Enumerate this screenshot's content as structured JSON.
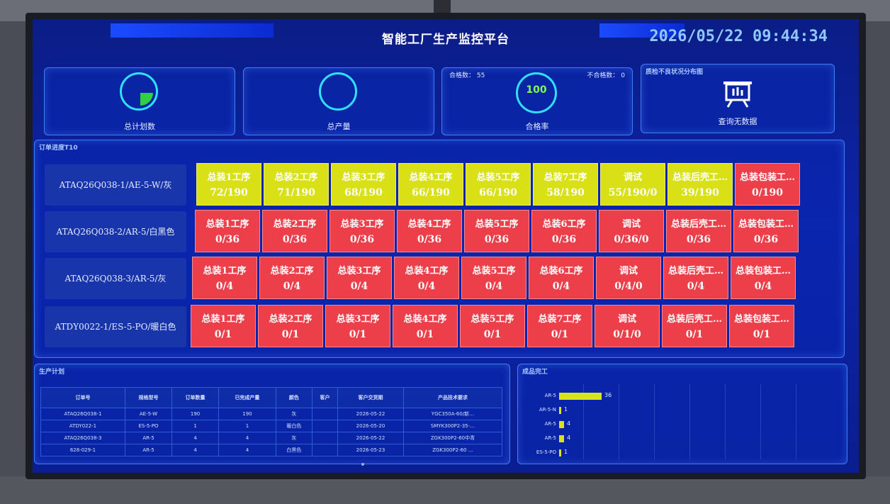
{
  "header": {
    "title": "智能工厂生产监控平台",
    "datetime": "2026/05/22  09:44:34"
  },
  "kpis": {
    "total_plan": {
      "label": "总计划数",
      "progress": 0.25
    },
    "total_output": {
      "label": "总产量"
    },
    "pass_rate": {
      "label": "合格率",
      "value": "100",
      "qualified_label": "合格数：",
      "qualified": "55",
      "unqualified_label": "不合格数：",
      "unqualified": "0"
    },
    "defects": {
      "title": "质检不良状况分布图",
      "empty": "查询无数据"
    }
  },
  "orders": {
    "title": "订单进度T10",
    "rows": [
      {
        "label": "ATAQ26Q038-1/AE-5-W/灰",
        "cells": [
          {
            "name": "总装1工序",
            "count": "72/190",
            "status": "yellow"
          },
          {
            "name": "总装2工序",
            "count": "71/190",
            "status": "yellow"
          },
          {
            "name": "总装3工序",
            "count": "68/190",
            "status": "yellow"
          },
          {
            "name": "总装4工序",
            "count": "66/190",
            "status": "yellow"
          },
          {
            "name": "总装5工序",
            "count": "66/190",
            "status": "yellow"
          },
          {
            "name": "总装7工序",
            "count": "58/190",
            "status": "yellow"
          },
          {
            "name": "调试",
            "count": "55/190/0",
            "status": "yellow"
          },
          {
            "name": "总装后壳工…",
            "count": "39/190",
            "status": "yellow"
          },
          {
            "name": "总装包装工…",
            "count": "0/190",
            "status": "red"
          }
        ]
      },
      {
        "label": "ATAQ26Q038-2/AR-5/白黑色",
        "cells": [
          {
            "name": "总装1工序",
            "count": "0/36",
            "status": "red"
          },
          {
            "name": "总装2工序",
            "count": "0/36",
            "status": "red"
          },
          {
            "name": "总装3工序",
            "count": "0/36",
            "status": "red"
          },
          {
            "name": "总装4工序",
            "count": "0/36",
            "status": "red"
          },
          {
            "name": "总装5工序",
            "count": "0/36",
            "status": "red"
          },
          {
            "name": "总装6工序",
            "count": "0/36",
            "status": "red"
          },
          {
            "name": "调试",
            "count": "0/36/0",
            "status": "red"
          },
          {
            "name": "总装后壳工…",
            "count": "0/36",
            "status": "red"
          },
          {
            "name": "总装包装工…",
            "count": "0/36",
            "status": "red"
          }
        ]
      },
      {
        "label": "ATAQ26Q038-3/AR-5/灰",
        "cells": [
          {
            "name": "总装1工序",
            "count": "0/4",
            "status": "red"
          },
          {
            "name": "总装2工序",
            "count": "0/4",
            "status": "red"
          },
          {
            "name": "总装3工序",
            "count": "0/4",
            "status": "red"
          },
          {
            "name": "总装4工序",
            "count": "0/4",
            "status": "red"
          },
          {
            "name": "总装5工序",
            "count": "0/4",
            "status": "red"
          },
          {
            "name": "总装6工序",
            "count": "0/4",
            "status": "red"
          },
          {
            "name": "调试",
            "count": "0/4/0",
            "status": "red"
          },
          {
            "name": "总装后壳工…",
            "count": "0/4",
            "status": "red"
          },
          {
            "name": "总装包装工…",
            "count": "0/4",
            "status": "red"
          }
        ]
      },
      {
        "label": "ATDY0022-1/ES-5-PO/暖白色",
        "cells": [
          {
            "name": "总装1工序",
            "count": "0/1",
            "status": "red"
          },
          {
            "name": "总装2工序",
            "count": "0/1",
            "status": "red"
          },
          {
            "name": "总装3工序",
            "count": "0/1",
            "status": "red"
          },
          {
            "name": "总装4工序",
            "count": "0/1",
            "status": "red"
          },
          {
            "name": "总装5工序",
            "count": "0/1",
            "status": "red"
          },
          {
            "name": "总装7工序",
            "count": "0/1",
            "status": "red"
          },
          {
            "name": "调试",
            "count": "0/1/0",
            "status": "red"
          },
          {
            "name": "总装后壳工…",
            "count": "0/1",
            "status": "red"
          },
          {
            "name": "总装包装工…",
            "count": "0/1",
            "status": "red"
          }
        ]
      }
    ]
  },
  "plan": {
    "title": "生产计划",
    "headers": [
      "订单号",
      "规格型号",
      "订单数量",
      "已完成产量",
      "颜色",
      "客户",
      "客户交货期",
      "产品技术要求"
    ],
    "rows": [
      [
        "ATAQ26Q038-1",
        "AE-5-W",
        "190",
        "190",
        "灰",
        "",
        "2026-05-22",
        "YGC350A-60/新…"
      ],
      [
        "ATDY022-1",
        "ES-5-PO",
        "1",
        "1",
        "暖白色",
        "",
        "2026-05-20",
        "SMYK300P2-35-…"
      ],
      [
        "ATAQ26Q038-3",
        "AR-5",
        "4",
        "4",
        "灰",
        "",
        "2026-05-22",
        "ZGK300P2-60中青"
      ],
      [
        "628-029-1",
        "AR-5",
        "4",
        "4",
        "白黑色",
        "",
        "2026-05-23",
        "ZGK300P2-60 …"
      ]
    ]
  },
  "finished": {
    "title": "成品完工",
    "bars": [
      {
        "label": "AR-5",
        "value": "36",
        "num": 36
      },
      {
        "label": "AR-5-N",
        "value": "1",
        "num": 1
      },
      {
        "label": "AR-5",
        "value": "4",
        "num": 4
      },
      {
        "label": "AR-5",
        "value": "4",
        "num": 4
      },
      {
        "label": "ES-5-PO",
        "value": "1",
        "num": 1
      }
    ]
  },
  "colors": {
    "yellow": "#d9e016",
    "red": "#ec3f4a",
    "accent": "#2fe0ff"
  }
}
